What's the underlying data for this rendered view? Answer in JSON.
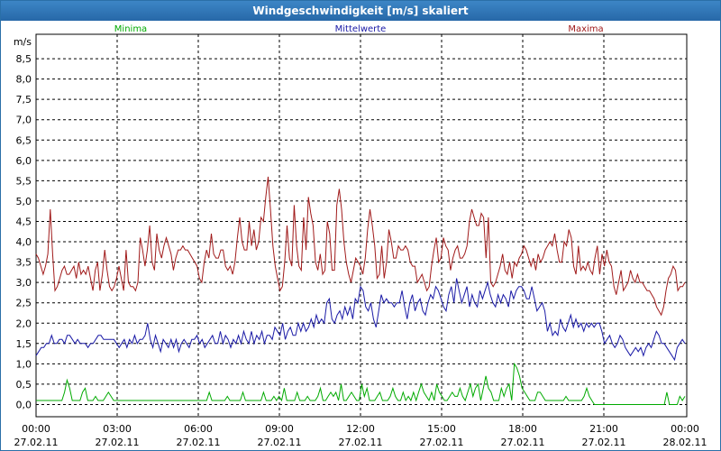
{
  "window": {
    "title": "Windgeschwindigkeit [m/s] skaliert"
  },
  "chart_data": {
    "type": "line",
    "title": "Windgeschwindigkeit [m/s] skaliert",
    "ylabel": "m/s",
    "xlabel": "",
    "ylim": [
      -0.3,
      9.1
    ],
    "xlim": [
      0,
      24
    ],
    "grid": true,
    "legend": "top",
    "y_ticks": [
      "0,0",
      "0,5",
      "1,0",
      "1,5",
      "2,0",
      "2,5",
      "3,0",
      "3,5",
      "4,0",
      "4,5",
      "5,0",
      "5,5",
      "6,0",
      "6,5",
      "7,0",
      "7,5",
      "8,0",
      "8,5"
    ],
    "x_ticks": [
      {
        "time": "00:00",
        "date": "27.02.11"
      },
      {
        "time": "03:00",
        "date": "27.02.11"
      },
      {
        "time": "06:00",
        "date": "27.02.11"
      },
      {
        "time": "09:00",
        "date": "27.02.11"
      },
      {
        "time": "12:00",
        "date": "27.02.11"
      },
      {
        "time": "15:00",
        "date": "27.02.11"
      },
      {
        "time": "18:00",
        "date": "27.02.11"
      },
      {
        "time": "21:00",
        "date": "27.02.11"
      },
      {
        "time": "00:00",
        "date": "28.02.11"
      }
    ],
    "series": [
      {
        "name": "Minima",
        "color": "#00aa00",
        "values": [
          0.1,
          0.1,
          0.1,
          0.1,
          0.1,
          0.1,
          0.1,
          0.1,
          0.1,
          0.1,
          0.1,
          0.3,
          0.6,
          0.4,
          0.1,
          0.1,
          0.1,
          0.1,
          0.3,
          0.4,
          0.1,
          0.1,
          0.1,
          0.2,
          0.1,
          0.1,
          0.1,
          0.2,
          0.3,
          0.2,
          0.1,
          0.1,
          0.1,
          0.1,
          0.1,
          0.1,
          0.1,
          0.1,
          0.1,
          0.1,
          0.1,
          0.1,
          0.1,
          0.1,
          0.1,
          0.1,
          0.1,
          0.1,
          0.1,
          0.1,
          0.1,
          0.1,
          0.1,
          0.1,
          0.1,
          0.1,
          0.1,
          0.1,
          0.1,
          0.1,
          0.1,
          0.1,
          0.1,
          0.1,
          0.1,
          0.1,
          0.1,
          0.3,
          0.1,
          0.1,
          0.1,
          0.1,
          0.1,
          0.1,
          0.2,
          0.1,
          0.1,
          0.1,
          0.1,
          0.1,
          0.3,
          0.1,
          0.1,
          0.1,
          0.1,
          0.1,
          0.1,
          0.1,
          0.3,
          0.1,
          0.1,
          0.1,
          0.2,
          0.1,
          0.2,
          0.1,
          0.4,
          0.1,
          0.1,
          0.1,
          0.1,
          0.3,
          0.1,
          0.1,
          0.1,
          0.2,
          0.1,
          0.1,
          0.1,
          0.2,
          0.4,
          0.1,
          0.1,
          0.2,
          0.3,
          0.2,
          0.3,
          0.1,
          0.5,
          0.1,
          0.1,
          0.2,
          0.3,
          0.2,
          0.1,
          0.1,
          0.5,
          0.2,
          0.4,
          0.1,
          0.1,
          0.1,
          0.2,
          0.3,
          0.1,
          0.1,
          0.1,
          0.2,
          0.4,
          0.2,
          0.1,
          0.1,
          0.3,
          0.1,
          0.2,
          0.1,
          0.3,
          0.1,
          0.3,
          0.5,
          0.3,
          0.2,
          0.1,
          0.3,
          0.1,
          0.5,
          0.3,
          0.2,
          0.1,
          0.1,
          0.2,
          0.3,
          0.2,
          0.2,
          0.4,
          0.2,
          0.1,
          0.3,
          0.5,
          0.2,
          0.4,
          0.5,
          0.1,
          0.4,
          0.7,
          0.4,
          0.3,
          0.1,
          0.1,
          0.1,
          0.4,
          0.2,
          0.4,
          0.5,
          0.1,
          1.0,
          0.9,
          0.7,
          0.4,
          0.3,
          0.2,
          0.1,
          0.1,
          0.1,
          0.3,
          0.3,
          0.2,
          0.1,
          0.1,
          0.1,
          0.1,
          0.1,
          0.1,
          0.1,
          0.1,
          0.2,
          0.1,
          0.1,
          0.1,
          0.1,
          0.1,
          0.1,
          0.2,
          0.4,
          0.2,
          0.1,
          0.0,
          0.0,
          0.0,
          0.0,
          0.0,
          0.0,
          0.0,
          0.0,
          0.0,
          0.0,
          0.0,
          0.0,
          0.0,
          0.0,
          0.0,
          0.0,
          0.0,
          0.0,
          0.0,
          0.0,
          0.0,
          0.0,
          0.0,
          0.0,
          0.0,
          0.0,
          0.0,
          0.0,
          0.3,
          0.0,
          0.0,
          0.0,
          0.0,
          0.2,
          0.1,
          0.2
        ]
      },
      {
        "name": "Mittelwerte",
        "color": "#1a1aa6",
        "values": [
          1.2,
          1.3,
          1.4,
          1.4,
          1.5,
          1.5,
          1.7,
          1.5,
          1.5,
          1.6,
          1.6,
          1.5,
          1.7,
          1.7,
          1.6,
          1.5,
          1.6,
          1.5,
          1.5,
          1.5,
          1.4,
          1.5,
          1.5,
          1.6,
          1.7,
          1.7,
          1.6,
          1.6,
          1.6,
          1.6,
          1.6,
          1.5,
          1.4,
          1.5,
          1.6,
          1.4,
          1.6,
          1.5,
          1.7,
          1.5,
          1.6,
          1.6,
          1.7,
          2.0,
          1.6,
          1.4,
          1.7,
          1.5,
          1.3,
          1.6,
          1.5,
          1.4,
          1.6,
          1.4,
          1.6,
          1.3,
          1.5,
          1.6,
          1.5,
          1.4,
          1.6,
          1.6,
          1.7,
          1.5,
          1.6,
          1.4,
          1.5,
          1.6,
          1.7,
          1.5,
          1.5,
          1.8,
          1.5,
          1.7,
          1.6,
          1.4,
          1.6,
          1.5,
          1.7,
          1.5,
          1.8,
          1.6,
          1.5,
          1.8,
          1.5,
          1.7,
          1.6,
          1.8,
          1.5,
          1.7,
          1.7,
          1.6,
          1.9,
          1.8,
          1.7,
          2.0,
          1.6,
          1.8,
          1.9,
          1.7,
          1.7,
          2.0,
          1.8,
          2.0,
          1.8,
          1.9,
          2.1,
          1.9,
          2.2,
          2.0,
          2.1,
          2.0,
          2.5,
          2.6,
          2.1,
          2.0,
          2.2,
          2.3,
          2.1,
          2.4,
          2.2,
          2.4,
          2.1,
          2.6,
          2.5,
          2.9,
          2.8,
          2.4,
          2.3,
          2.5,
          2.1,
          1.9,
          2.3,
          2.7,
          2.5,
          2.6,
          2.5,
          2.5,
          2.4,
          2.5,
          2.5,
          2.8,
          2.4,
          2.1,
          2.5,
          2.7,
          2.3,
          2.5,
          2.6,
          2.3,
          2.2,
          2.5,
          2.7,
          2.6,
          2.9,
          2.8,
          2.6,
          2.4,
          2.3,
          2.7,
          2.9,
          2.5,
          3.1,
          2.8,
          2.5,
          2.7,
          2.9,
          2.4,
          2.7,
          2.5,
          2.4,
          2.8,
          2.6,
          2.8,
          3.0,
          2.7,
          2.5,
          2.4,
          2.7,
          2.5,
          2.7,
          2.6,
          2.4,
          2.8,
          2.6,
          2.8,
          2.9,
          2.9,
          2.8,
          2.6,
          2.6,
          2.9,
          2.6,
          2.3,
          2.4,
          2.5,
          2.3,
          1.8,
          2.0,
          1.7,
          1.8,
          1.7,
          2.1,
          1.9,
          1.8,
          2.0,
          2.2,
          1.9,
          2.1,
          1.9,
          2.0,
          1.8,
          2.0,
          1.9,
          2.0,
          1.9,
          2.0,
          2.0,
          1.8,
          1.5,
          1.6,
          1.7,
          1.5,
          1.4,
          1.5,
          1.7,
          1.6,
          1.4,
          1.3,
          1.2,
          1.3,
          1.4,
          1.3,
          1.4,
          1.2,
          1.4,
          1.5,
          1.4,
          1.6,
          1.8,
          1.7,
          1.5,
          1.5,
          1.4,
          1.3,
          1.2,
          1.1,
          1.4,
          1.5,
          1.6,
          1.5
        ]
      },
      {
        "name": "Maxima",
        "color": "#a01a1a",
        "values": [
          3.7,
          3.6,
          3.4,
          3.2,
          3.4,
          3.7,
          4.8,
          3.7,
          2.8,
          2.9,
          3.1,
          3.3,
          3.4,
          3.2,
          3.2,
          3.3,
          3.4,
          3.1,
          3.5,
          3.2,
          3.3,
          3.2,
          3.4,
          3.1,
          2.8,
          3.3,
          3.5,
          2.8,
          3.2,
          3.8,
          3.3,
          2.9,
          2.8,
          2.9,
          3.1,
          3.4,
          3.1,
          2.8,
          3.8,
          3.0,
          2.9,
          2.9,
          2.8,
          3.0,
          4.1,
          3.8,
          3.4,
          3.8,
          4.4,
          3.5,
          3.3,
          4.2,
          3.8,
          3.6,
          3.9,
          4.1,
          3.9,
          3.7,
          3.3,
          3.6,
          3.8,
          3.8,
          3.9,
          3.8,
          3.8,
          3.7,
          3.6,
          3.5,
          3.4,
          3.1,
          3.0,
          3.5,
          3.8,
          3.6,
          4.2,
          3.7,
          3.6,
          3.6,
          3.8,
          3.8,
          3.4,
          3.3,
          3.4,
          3.2,
          3.5,
          4.1,
          4.6,
          4.0,
          3.8,
          3.8,
          4.5,
          3.9,
          4.3,
          3.8,
          4.0,
          4.6,
          4.5,
          5.1,
          5.6,
          4.8,
          3.9,
          3.4,
          3.1,
          2.8,
          2.9,
          3.5,
          4.4,
          3.6,
          3.4,
          4.9,
          3.9,
          3.4,
          3.3,
          4.6,
          3.8,
          5.1,
          4.7,
          4.4,
          3.5,
          3.3,
          3.7,
          3.2,
          3.3,
          4.5,
          4.2,
          3.3,
          3.3,
          4.9,
          5.3,
          4.8,
          4.0,
          3.5,
          3.2,
          3.0,
          3.3,
          3.6,
          3.5,
          3.4,
          3.2,
          3.6,
          4.3,
          4.8,
          4.4,
          3.9,
          3.1,
          3.2,
          3.9,
          3.1,
          3.5,
          4.3,
          4.0,
          3.6,
          3.6,
          3.9,
          3.8,
          3.8,
          3.9,
          3.8,
          3.5,
          3.4,
          3.4,
          3.0,
          3.1,
          3.2,
          3.0,
          2.8,
          2.9,
          3.4,
          3.8,
          4.1,
          3.5,
          3.6,
          4.1,
          3.9,
          3.8,
          3.3,
          3.6,
          3.8,
          3.9,
          3.6,
          3.6,
          3.7,
          3.9,
          4.5,
          4.8,
          4.6,
          4.4,
          4.4,
          4.7,
          4.6,
          3.6,
          4.6,
          3.0,
          2.9,
          3.0,
          3.2,
          3.4,
          3.7,
          3.3,
          3.2,
          3.5,
          3.1,
          3.5,
          3.4,
          3.6,
          3.7,
          3.9,
          3.8,
          3.6,
          3.4,
          3.6,
          3.3,
          3.7,
          3.5,
          3.6,
          3.8,
          3.9,
          4.0,
          3.9,
          4.2,
          3.8,
          3.5,
          3.5,
          4.0,
          3.9,
          4.3,
          4.1,
          3.4,
          3.2,
          3.9,
          3.3,
          3.4,
          3.3,
          3.5,
          3.3,
          3.2,
          3.6,
          3.9,
          3.2,
          3.7,
          3.4,
          3.8,
          3.5,
          3.4,
          2.9,
          2.7,
          3.0,
          3.3,
          2.8,
          2.9,
          3.0,
          3.3,
          3.1,
          3.0,
          3.2,
          3.0,
          3.0,
          2.9,
          2.8,
          2.8,
          2.7,
          2.6,
          2.4,
          2.3,
          2.2,
          2.4,
          2.8,
          3.1,
          3.2,
          3.4,
          3.3,
          2.8,
          2.9,
          2.9,
          3.0
        ]
      }
    ]
  }
}
